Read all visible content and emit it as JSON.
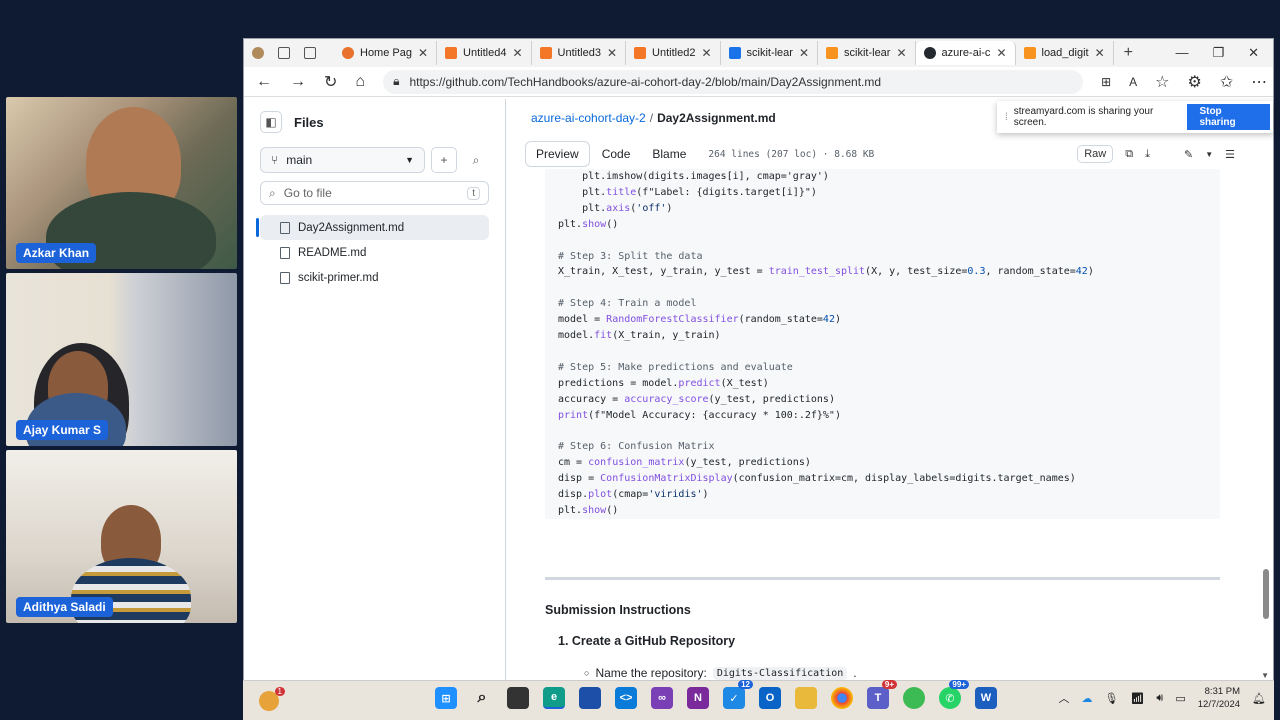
{
  "participants": [
    {
      "name": "Azkar Khan"
    },
    {
      "name": "Ajay Kumar S"
    },
    {
      "name": "Adithya Saladi"
    }
  ],
  "browser": {
    "tabs": [
      {
        "label": "Home Pag",
        "icon": "loading-icon"
      },
      {
        "label": "Untitled4",
        "icon": "jupyter-icon"
      },
      {
        "label": "Untitled3",
        "icon": "jupyter-icon"
      },
      {
        "label": "Untitled2",
        "icon": "jupyter-icon"
      },
      {
        "label": "scikit-lear",
        "icon": "search-icon"
      },
      {
        "label": "scikit-lear",
        "icon": "scikit-icon"
      },
      {
        "label": "azure-ai-c",
        "icon": "github-icon",
        "active": true
      },
      {
        "label": "load_digit",
        "icon": "scikit-icon"
      }
    ],
    "url": "https://github.com/TechHandbooks/azure-ai-cohort-day-2/blob/main/Day2Assignment.md"
  },
  "sharing": {
    "message": "streamyard.com is sharing your screen.",
    "button": "Stop sharing"
  },
  "sidebar": {
    "title": "Files",
    "branch": "main",
    "goto_placeholder": "Go to file",
    "goto_shortcut": "t",
    "files": [
      {
        "name": "Day2Assignment.md",
        "selected": true
      },
      {
        "name": "README.md"
      },
      {
        "name": "scikit-primer.md"
      }
    ]
  },
  "main": {
    "repo_link": "azure-ai-cohort-day-2",
    "separator": "/",
    "file_name": "Day2Assignment.md",
    "tabs": [
      "Preview",
      "Code",
      "Blame"
    ],
    "meta": "264 lines (207 loc) · 8.68 KB",
    "raw_label": "Raw",
    "submission_heading": "Submission Instructions",
    "step1": "1. Create a GitHub Repository",
    "bullet_text": "Name the repository:",
    "bullet_code": "Digits-Classification",
    "bullet_end": "."
  },
  "taskbar": {
    "time": "8:31 PM",
    "date": "12/7/2024"
  }
}
